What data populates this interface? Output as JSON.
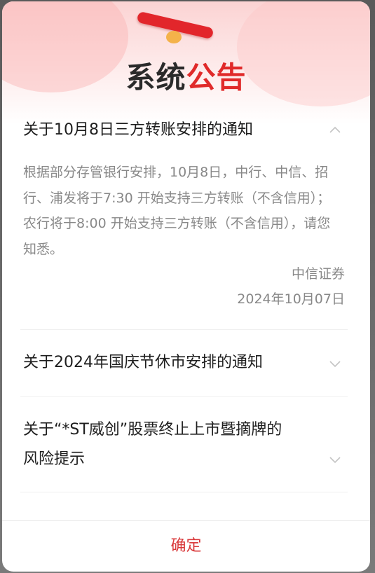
{
  "dialog": {
    "title_part1": "系统",
    "title_part2": "公告",
    "confirm_label": "确定"
  },
  "announcements": [
    {
      "title": "关于10月8日三方转账安排的通知",
      "expanded": true,
      "body": "根据部分存管银行安排，10月8日，中行、中信、招行、浦发将于7:30 开始支持三方转账（不含信用）；农行将于8:00 开始支持三方转账（不含信用），请您知悉。",
      "issuer": "中信证券",
      "date": "2024年10月07日"
    },
    {
      "title": "关于2024年国庆节休市安排的通知",
      "expanded": false
    },
    {
      "title_line1": "关于“*ST威创”股票终止上市暨摘牌的",
      "title_line2": "风险提示",
      "expanded": false
    }
  ],
  "colors": {
    "accent_red": "#e02a2a",
    "confirm_red": "#d9383a",
    "body_gray": "#888888"
  }
}
